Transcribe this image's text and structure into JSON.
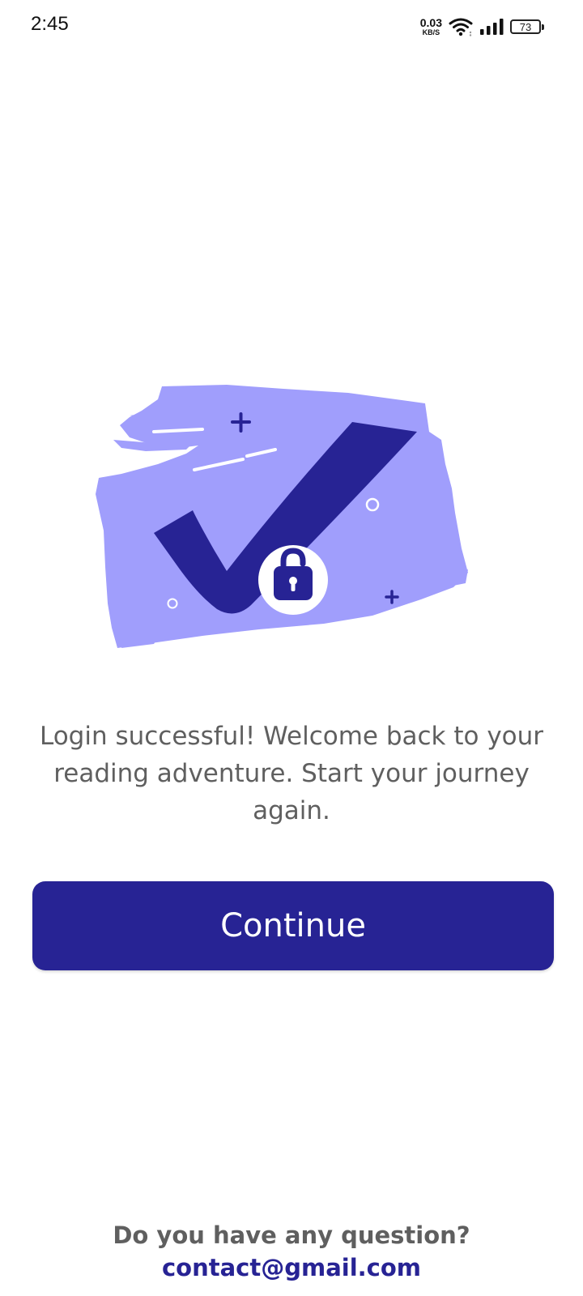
{
  "status_bar": {
    "time": "2:45",
    "net_speed_value": "0.03",
    "net_speed_unit": "KB/S",
    "battery": "73"
  },
  "message": "Login successful! Welcome back to your reading adventure. Start your journey again.",
  "continue_label": "Continue",
  "footer": {
    "question": "Do you have any question?",
    "email": "contact@gmail.com"
  },
  "colors": {
    "primary": "#272394",
    "brush": "#A09EFC",
    "text": "#5f5f5f"
  }
}
